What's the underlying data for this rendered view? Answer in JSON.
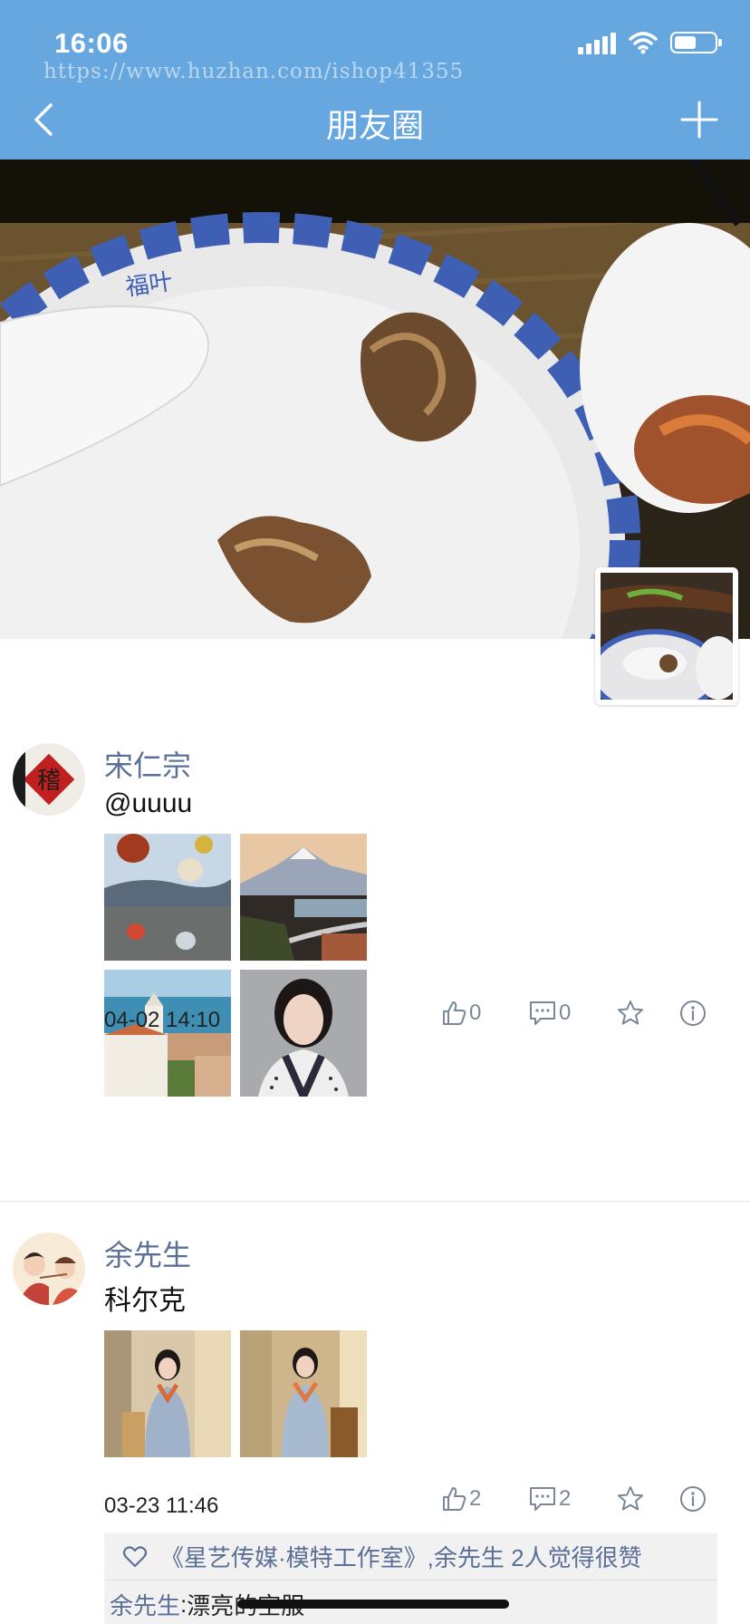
{
  "status_bar": {
    "time": "16:06",
    "battery_level": 0.55
  },
  "watermark": "https://www.huzhan.com/ishop41355",
  "nav": {
    "title": "朋友圈"
  },
  "cover": {
    "plate_text": "福叶"
  },
  "posts": [
    {
      "author": "宋仁宗",
      "content": "@uuuu",
      "images": [
        "hot-air-balloons",
        "snowy-mountain-road",
        "seaside-church",
        "woman-portrait"
      ],
      "timestamp": "04-02 14:10",
      "likes": "0",
      "comments": "0",
      "avatar_text": "稽"
    },
    {
      "author": "余先生",
      "content": "科尔克",
      "images": [
        "model-photo-1",
        "model-photo-2"
      ],
      "timestamp": "03-23 11:46",
      "likes": "2",
      "comments": "2",
      "liked_by": "《星艺传媒·模特工作室》,余先生 2人觉得很赞",
      "comment": {
        "author": "余先生",
        "separator": ":",
        "text": "漂亮的空服"
      }
    }
  ],
  "colors": {
    "header": "#67a7df",
    "name": "#5b6f97",
    "icon": "#7b8798"
  }
}
